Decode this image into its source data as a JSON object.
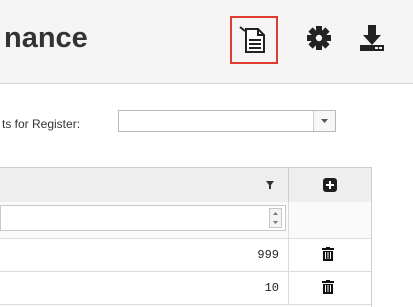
{
  "header": {
    "title": "nance",
    "icons": [
      "notes-document-icon",
      "gear-icon",
      "download-icon"
    ],
    "highlight_color": "#e03c31"
  },
  "filter": {
    "label": "ts for Register:",
    "select_value": ""
  },
  "grid": {
    "filter_value": "",
    "rows": [
      {
        "value": "999"
      },
      {
        "value": "10"
      }
    ],
    "icons": [
      "filter-icon",
      "add-icon",
      "trash-icon"
    ]
  }
}
